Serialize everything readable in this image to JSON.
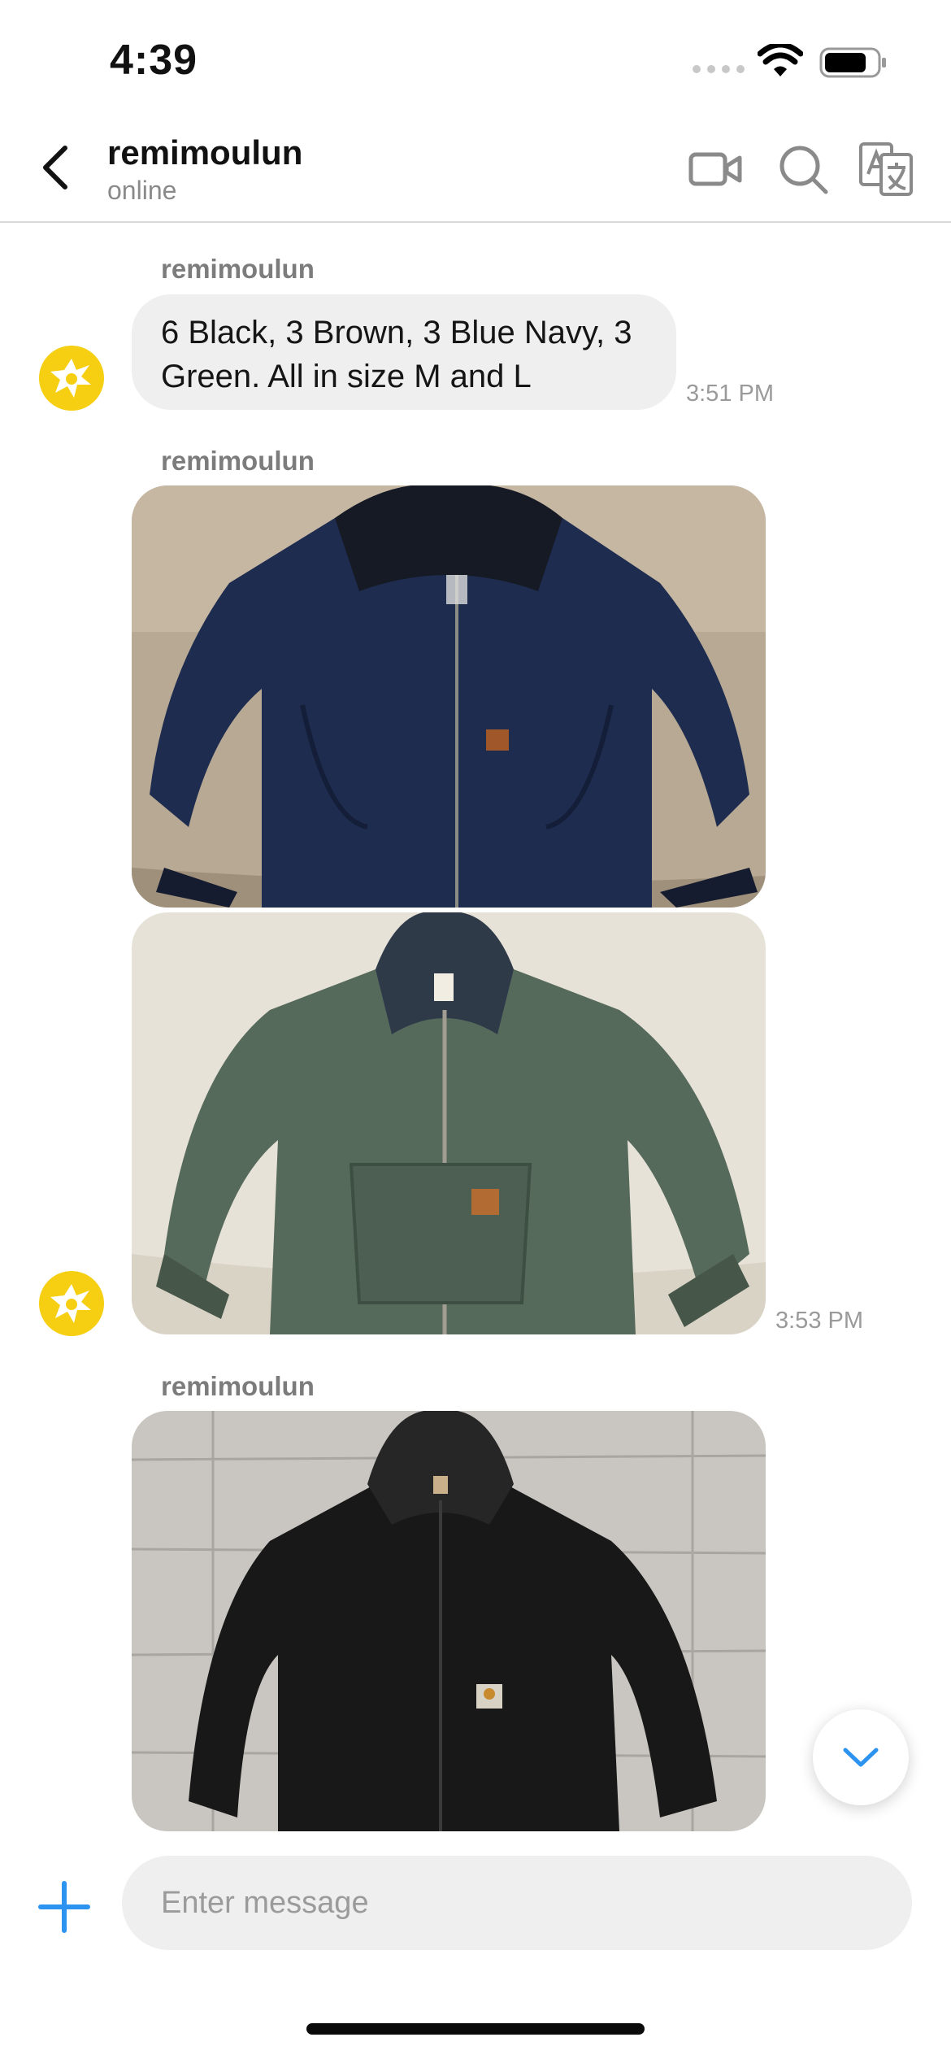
{
  "status_bar": {
    "time": "4:39"
  },
  "header": {
    "title": "remimoulun",
    "subtitle": "online"
  },
  "messages": [
    {
      "sender": "remimoulun",
      "text": "6 Black, 3 Brown, 3 Blue Navy, 3 Green. All in size M and L",
      "time": "3:51 PM"
    },
    {
      "sender": "remimoulun",
      "images": [
        "navy jacket photo",
        "green jacket photo"
      ],
      "time": "3:53 PM"
    },
    {
      "sender": "remimoulun",
      "images": [
        "black jacket photo"
      ]
    }
  ],
  "composer": {
    "placeholder": "Enter message"
  },
  "colors": {
    "accent": "#2c93f0",
    "avatar": "#f6cf12",
    "bubble": "#efefef"
  },
  "icons": [
    "back-icon",
    "video-call-icon",
    "search-icon",
    "translate-icon",
    "avatar-icon",
    "chevron-down-icon",
    "plus-icon"
  ]
}
